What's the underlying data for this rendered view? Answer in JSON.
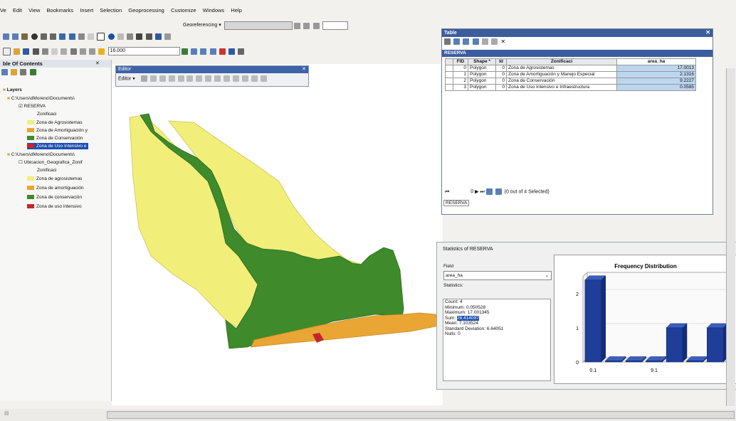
{
  "menu": [
    "Ve",
    "Edit",
    "View",
    "Bookmarks",
    "Insert",
    "Selection",
    "Geoprocessing",
    "Customize",
    "Windows",
    "Help"
  ],
  "georef_label": "Georeferencing ▾",
  "scale": "16.000",
  "toc": {
    "title": "ble Of Contents",
    "layers_label": "Layers",
    "group1_path": "C:\\Users\\dMoreno\\Documents\\",
    "layer1": "RESERVA",
    "layer1_field": "Zonificaci",
    "layer1_items": [
      {
        "label": "Zona de Agrosistemas",
        "color": "#f1ef7a"
      },
      {
        "label": "Zona de Amortiguación y",
        "color": "#e9a634"
      },
      {
        "label": "Zona de Conservación",
        "color": "#3f8a2a"
      },
      {
        "label": "Zona de Uso Intensivo e",
        "color": "#c5262d"
      }
    ],
    "group2_path": "C:\\Users\\dMoreno\\Documents\\",
    "layer2": "Ubicacion_Geografica_Zonif",
    "layer2_field": "Zonificaci",
    "layer2_items": [
      {
        "label": "Zona de agrosistemas",
        "color": "#f1ef7a"
      },
      {
        "label": "Zona de amortiguación",
        "color": "#e9a634"
      },
      {
        "label": "Zona de conservación",
        "color": "#3f8a2a"
      },
      {
        "label": "Zona de uso intensivo",
        "color": "#c5262d"
      }
    ]
  },
  "editor": {
    "title": "Editor",
    "menu_label": "Editor ▾"
  },
  "table_window": {
    "title": "Table",
    "sub_title": "RESERVA",
    "columns": [
      "FID",
      "Shape *",
      "Id",
      "Zonificaci",
      "area_ha"
    ],
    "rows": [
      [
        "0",
        "Polygon",
        "0",
        "Zona de Agrosistemas",
        "17.0013"
      ],
      [
        "1",
        "Polygon",
        "0",
        "Zona de Amortiguación y Manejo Especial",
        "2.1316"
      ],
      [
        "2",
        "Polygon",
        "0",
        "Zona de Conservación",
        "9.2227"
      ],
      [
        "3",
        "Polygon",
        "0",
        "Zona de Uso Intensivo e Infraestructura",
        "0.0585"
      ]
    ],
    "nav_record": "0",
    "selection_text": "(0 out of 4 Selected)",
    "tab_label": "RESERVA"
  },
  "statistics": {
    "title": "Statistics of RESERVA",
    "field_label": "Field",
    "field_value": "area_ha",
    "stats_label": "Statistics:",
    "lines": [
      {
        "label": "Count:",
        "value": "4"
      },
      {
        "label": "Minimum:",
        "value": "0.050528"
      },
      {
        "label": "Maximum:",
        "value": "17.001345"
      },
      {
        "label": "Sum:",
        "value": "28.414097"
      },
      {
        "label": "Mean:",
        "value": "7.103524"
      },
      {
        "label": "Standard Deviation:",
        "value": "6.64051"
      },
      {
        "label": "Nulls:",
        "value": "0"
      }
    ],
    "chart_title": "Frequency Distribution"
  },
  "chart_data": {
    "type": "bar",
    "title": "Frequency Distribution",
    "values": [
      2.4,
      0,
      0,
      0,
      1,
      0,
      1
    ],
    "yticks": [
      "0",
      "1",
      "2"
    ],
    "xticks": [
      "0.1",
      "9.1"
    ],
    "ylim": [
      0,
      2.5
    ],
    "bar_color": "#1f3e9a"
  },
  "map": {
    "colors": {
      "agro": "#f1ef7a",
      "amort": "#e9a634",
      "cons": "#3f8a2a",
      "uso": "#c5262d"
    }
  }
}
